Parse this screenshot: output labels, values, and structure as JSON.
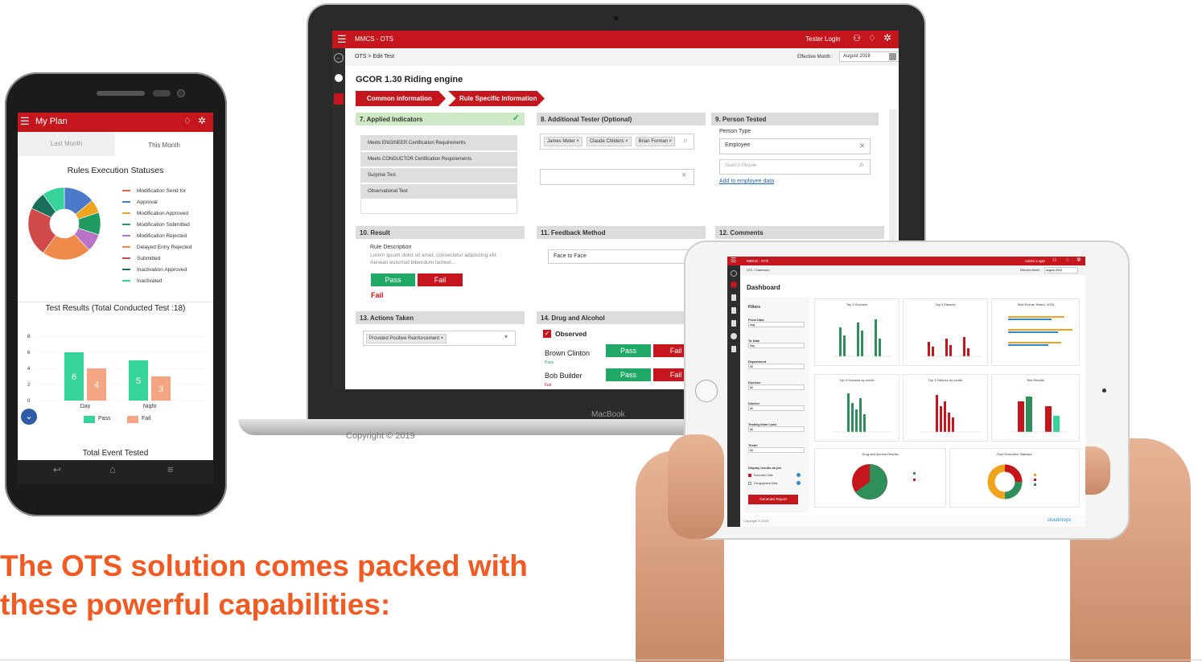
{
  "headline": {
    "line1": "The OTS solution comes packed with",
    "line2": "these powerful capabilities:"
  },
  "colors": {
    "brand_red": "#c4161c",
    "accent_orange": "#f15a22",
    "pass_green": "#1fa866"
  },
  "laptop": {
    "app_title": "MMCS - OTS",
    "user": "Tester Login",
    "breadcrumb": "OTS > Edit Test",
    "effective_month_label": "Effective Month :",
    "effective_month_value": "August 2018",
    "test_title": "GCOR 1.30  Riding engine",
    "tabs": [
      "Common information",
      "Rule Specific Information"
    ],
    "applied_indicators": {
      "header": "7.  Applied Indicators",
      "items": [
        "Meets ENGINEER Certification Requirements",
        "Meets CONDUCTOR Certification Requirements",
        "Surprise Test",
        "Observational Test"
      ]
    },
    "additional_tester": {
      "header": "8.  Additional Tester (Optional)",
      "chips": [
        "James Meter",
        "Claude Childers",
        "Brian Forman"
      ]
    },
    "person_tested": {
      "header": "9.  Person Tested",
      "type_label": "Person Type",
      "type_value": "Employee",
      "search_placeholder": "Search People",
      "add_link": "Add to employee data"
    },
    "result": {
      "header": "10.  Result",
      "rule_desc_label": "Rule Description",
      "rule_desc": "Lorem ipsum dolor sit amet, consectetur adipiscing elit. Aenean euismod bibendum laoreet...",
      "pass": "Pass",
      "fail": "Fail",
      "selected": "Fail"
    },
    "feedback": {
      "header": "11.  Feedback Method",
      "value": "Face to Face"
    },
    "comments": {
      "header": "12.  Comments"
    },
    "actions": {
      "header": "13.  Actions Taken",
      "chip": "Provided Positive Reinforcement"
    },
    "drug": {
      "header": "14.  Drug and Alcohol",
      "observed": "Observed",
      "people": [
        {
          "name": "Brown Clinton",
          "status": "Pass"
        },
        {
          "name": "Bob Builder",
          "status": "Fail"
        }
      ],
      "pass": "Pass",
      "fail": "Fail"
    },
    "brand": "MacBook",
    "copyright": "Copyright © 2019"
  },
  "phone": {
    "title": "My Plan",
    "tabs": [
      "Last Month",
      "This Month"
    ],
    "rules_title": "Rules Execution Statuses",
    "legend": [
      {
        "label": "Modification Send for",
        "color": "#e8663d"
      },
      {
        "label": "Approval",
        "color": "#4a7ac9"
      },
      {
        "label": "Modification Approved",
        "color": "#f0a31c"
      },
      {
        "label": "Modification Submitted",
        "color": "#1f9b5f"
      },
      {
        "label": "Modification Rejected",
        "color": "#b974c7"
      },
      {
        "label": "Delayed Entry Rejected",
        "color": "#f08a4b"
      },
      {
        "label": "Submitted",
        "color": "#d04a4a"
      },
      {
        "label": "Inactivation Approved",
        "color": "#1a6f5a"
      },
      {
        "label": "Inactivated",
        "color": "#36d39a"
      }
    ],
    "test_results_title": "Test Results (Total Conducted Test :18)",
    "yticks": [
      "8",
      "6",
      "4",
      "2",
      "0"
    ],
    "total_title": "Total Event Tested"
  },
  "chart_data": [
    {
      "type": "pie",
      "title": "Rules Execution Statuses",
      "labels": [
        "Modification Send for Approval",
        "Modification Approved",
        "Modification Submitted",
        "Modification Rejected",
        "Delayed Entry Rejected",
        "Submitted",
        "Inactivation Approved",
        "Inactivated"
      ],
      "values": [
        14,
        6,
        10,
        8,
        22,
        22,
        8,
        10
      ]
    },
    {
      "type": "bar",
      "title": "Test Results (Total Conducted Test :18)",
      "categories": [
        "Day",
        "Night"
      ],
      "ylim": [
        0,
        8
      ],
      "series": [
        {
          "name": "Pass",
          "values": [
            6,
            5
          ],
          "color": "#36d39a"
        },
        {
          "name": "Fail",
          "values": [
            4,
            3
          ],
          "color": "#f4a582"
        }
      ]
    }
  ],
  "tablet": {
    "app_title": "MMCS - OTS",
    "user": "Admin Login",
    "breadcrumb": "OTS > Dashboard",
    "effective": "Effective Month :",
    "effective_value": "August 2018",
    "page_title": "Dashboard",
    "filters_title": "Filters",
    "filters": [
      {
        "label": "From Date",
        "value": "Aug"
      },
      {
        "label": "To Date",
        "value": "Sep"
      },
      {
        "label": "Department",
        "value": "All"
      },
      {
        "label": "Division",
        "value": "All"
      },
      {
        "label": "District",
        "value": "All"
      },
      {
        "label": "Testing team Lead",
        "value": "All"
      },
      {
        "label": "Tester",
        "value": "All"
      }
    ],
    "display_label": "Display results as per",
    "display_options": [
      "Execution Date",
      "Geographical Data"
    ],
    "generate": "Generate Report",
    "cards": [
      "Top 3 Success",
      "Top 3 Failures",
      "Total Events Tested -2018",
      "Top 3 Success by month",
      "Top 3 Failures by month",
      "Test Results",
      "Drug and Alcohol Results",
      "Rule Execution Statuses"
    ],
    "copyright": "Copyright © 2019",
    "brand": "cloudmoyo"
  }
}
